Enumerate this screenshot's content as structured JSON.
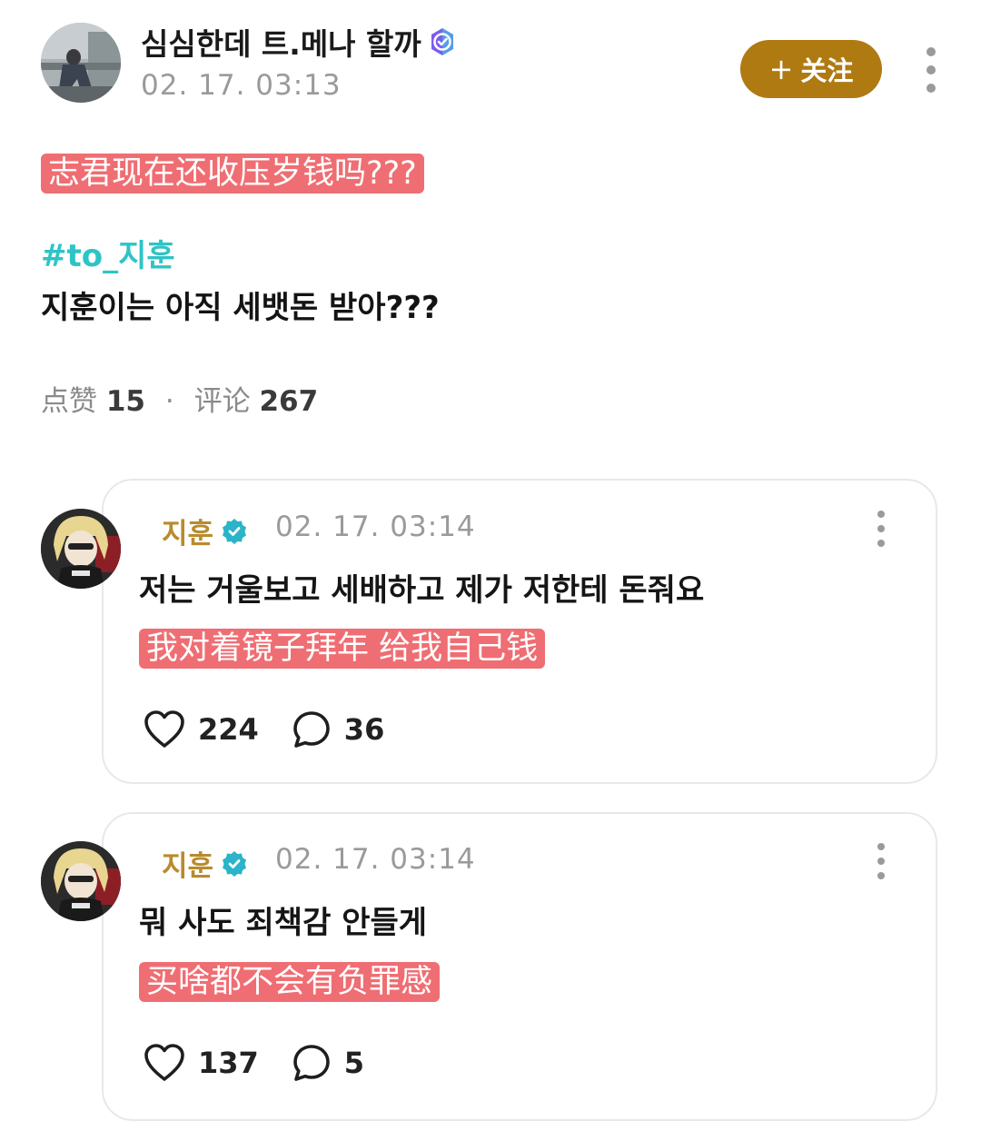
{
  "post": {
    "author": "심심한데 트.메나 할까",
    "time": "02. 17. 03:13",
    "follow_label": "关注",
    "follow_plus": "+",
    "translation": "志君现在还收压岁钱吗???",
    "hashtag": "#to_지훈",
    "body": "지훈이는 아직 세뱃돈 받아???",
    "stats": {
      "likes_label": "点赞",
      "likes": "15",
      "separator": "·",
      "comments_label": "评论",
      "comments": "267"
    }
  },
  "comments": [
    {
      "author": "지훈",
      "time": "02. 17. 03:14",
      "text": "저는 거울보고 세배하고 제가 저한테 돈줘요",
      "translation": "我对着镜子拜年 给我自己钱",
      "likes": "224",
      "replies": "36"
    },
    {
      "author": "지훈",
      "time": "02. 17. 03:14",
      "text": "뭐 사도 죄책감 안들게",
      "translation": "买啥都不会有负罪感",
      "likes": "137",
      "replies": "5"
    }
  ],
  "icons": {
    "verified_post": "verified-badge-icon",
    "verified_comment": "verified-badge-icon",
    "more": "more-vertical-icon",
    "like": "heart-icon",
    "reply": "speech-bubble-icon"
  },
  "colors": {
    "follow_button": "#b07a12",
    "highlight": "#ef6e73",
    "hashtag": "#2ec4c6",
    "comment_author": "#b88b2e",
    "verified_post": "#7b5cf0",
    "verified_comment": "#2bb3c9"
  }
}
